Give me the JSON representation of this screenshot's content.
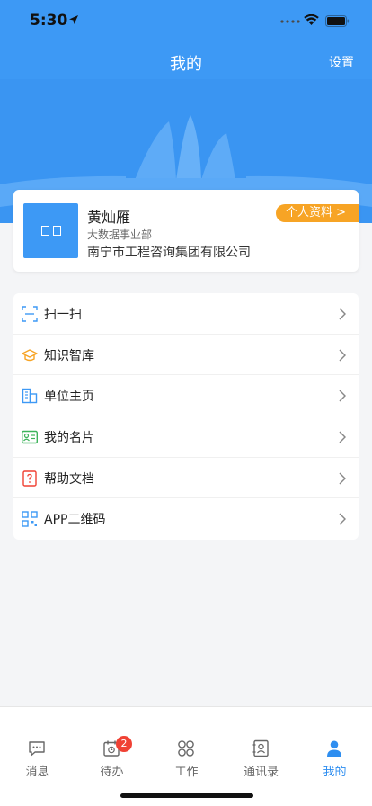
{
  "status": {
    "time": "5:30"
  },
  "nav": {
    "title": "我的",
    "settings_label": "设置"
  },
  "profile": {
    "name": "黄灿雁",
    "department": "大数据事业部",
    "company": "南宁市工程咨询集团有限公司",
    "profile_button": "个人资料 >"
  },
  "menu": [
    {
      "label": "扫一扫",
      "icon": "scan-icon"
    },
    {
      "label": "知识智库",
      "icon": "graduation-cap-icon"
    },
    {
      "label": "单位主页",
      "icon": "building-icon"
    },
    {
      "label": "我的名片",
      "icon": "business-card-icon"
    },
    {
      "label": "帮助文档",
      "icon": "help-document-icon"
    },
    {
      "label": "APP二维码",
      "icon": "qr-code-icon"
    }
  ],
  "tabs": [
    {
      "label": "消息",
      "icon": "message-icon"
    },
    {
      "label": "待办",
      "icon": "calendar-todo-icon",
      "badge": "2"
    },
    {
      "label": "工作",
      "icon": "grid-apps-icon"
    },
    {
      "label": "通讯录",
      "icon": "contacts-icon"
    },
    {
      "label": "我的",
      "icon": "person-icon",
      "active": true
    }
  ],
  "colors": {
    "primary": "#3d99f5",
    "accent": "#f7a425",
    "badge": "#f04134",
    "active_tab": "#2e8ef0"
  }
}
